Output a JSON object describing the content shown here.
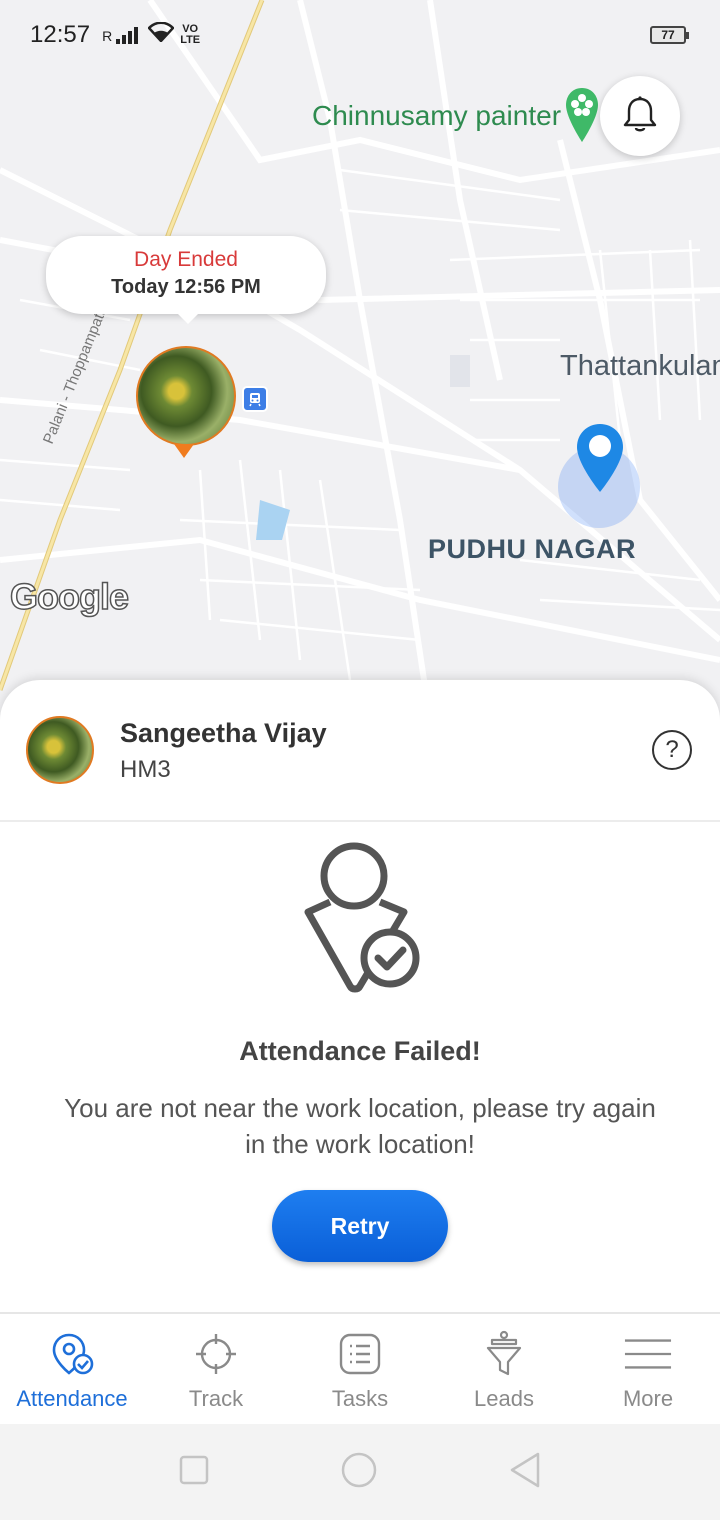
{
  "status_bar": {
    "time": "12:57",
    "signal_label": "R",
    "volte_top": "VO",
    "volte_bottom": "LTE",
    "battery": "77"
  },
  "map": {
    "poi_label": "Chinnusamy painter",
    "place_1": "Thattankulam",
    "place_2": "PUDHU NAGAR",
    "road_label": "Palani - Thoppampatti - Dharap",
    "google": "Google",
    "bubble": {
      "status": "Day Ended",
      "when": "Today 12:56 PM"
    }
  },
  "user": {
    "name": "Sangeetha Vijay",
    "code": "HM3",
    "help": "?"
  },
  "attendance": {
    "title": "Attendance Failed!",
    "message": "You are not near the work location, please try again in the work location!",
    "retry_label": "Retry"
  },
  "nav": [
    {
      "label": "Attendance",
      "icon": "attendance-pin-icon",
      "active": true
    },
    {
      "label": "Track",
      "icon": "crosshair-icon",
      "active": false
    },
    {
      "label": "Tasks",
      "icon": "tasks-list-icon",
      "active": false
    },
    {
      "label": "Leads",
      "icon": "funnel-icon",
      "active": false
    },
    {
      "label": "More",
      "icon": "menu-lines-icon",
      "active": false
    }
  ],
  "colors": {
    "accent": "#1e6fd9",
    "error": "#d83a3a",
    "marker": "#f07c1e"
  }
}
